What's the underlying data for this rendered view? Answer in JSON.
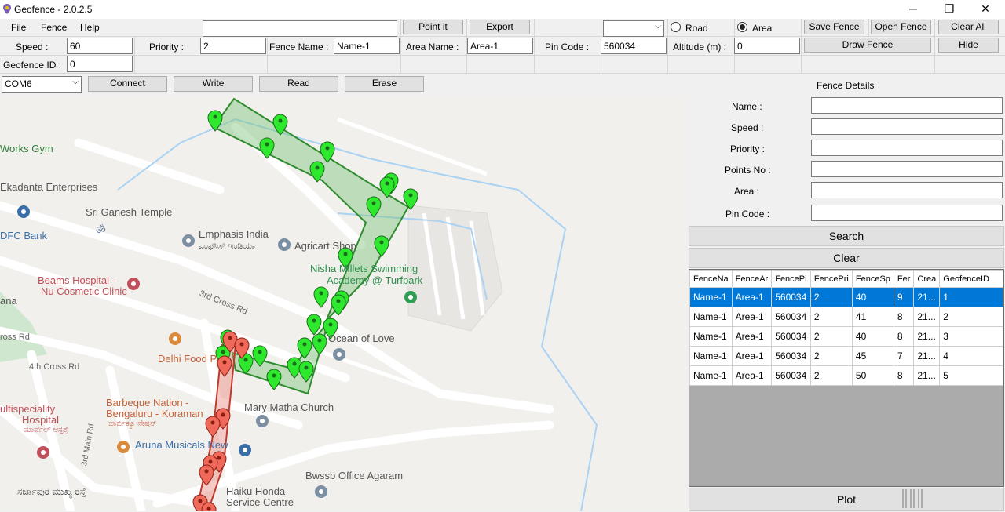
{
  "window": {
    "title": "Geofence - 2.0.2.5",
    "minimize": "─",
    "maximize": "❐",
    "close": "✕"
  },
  "menu": [
    "File",
    "Fence",
    "Help"
  ],
  "toolbar": {
    "speed_label": "Speed :",
    "speed_value": "60",
    "priority_label": "Priority :",
    "priority_value": "2",
    "fence_name_label": "Fence Name :",
    "fence_name_value": "Name-1",
    "area_name_label": "Area Name :",
    "area_name_value": "Area-1",
    "pin_code_label": "Pin Code :",
    "pin_code_value": "560034",
    "altitude_label": "Altitude (m) :",
    "altitude_value": "0",
    "geofence_id_label": "Geofence ID :",
    "geofence_id_value": "0",
    "search_value": "",
    "point_it": "Point it",
    "export": "Export",
    "dropdown_value": "",
    "radio_road": "Road",
    "radio_area": "Area",
    "selected_radio": "Area",
    "save_fence": "Save Fence",
    "open_fence": "Open Fence",
    "clear_all": "Clear All",
    "draw_fence": "Draw Fence",
    "hide": "Hide"
  },
  "serial": {
    "port": "COM6",
    "connect": "Connect",
    "write": "Write",
    "read": "Read",
    "erase": "Erase"
  },
  "details": {
    "title": "Fence Details",
    "fields": [
      {
        "label": "Name :",
        "value": ""
      },
      {
        "label": "Speed :",
        "value": ""
      },
      {
        "label": "Priority :",
        "value": ""
      },
      {
        "label": "Points No :",
        "value": ""
      },
      {
        "label": "Area :",
        "value": ""
      },
      {
        "label": "Pin Code :",
        "value": ""
      }
    ],
    "search": "Search",
    "clear": "Clear",
    "plot": "Plot"
  },
  "table": {
    "columns": [
      "FenceNa",
      "FenceAr",
      "FencePi",
      "FencePri",
      "FenceSp",
      "Fer",
      "Crea",
      "GeofenceID"
    ],
    "rows": [
      [
        "Name-1",
        "Area-1",
        "560034",
        "2",
        "40",
        "9",
        "21...",
        "1"
      ],
      [
        "Name-1",
        "Area-1",
        "560034",
        "2",
        "41",
        "8",
        "21...",
        "2"
      ],
      [
        "Name-1",
        "Area-1",
        "560034",
        "2",
        "40",
        "8",
        "21...",
        "3"
      ],
      [
        "Name-1",
        "Area-1",
        "560034",
        "2",
        "45",
        "7",
        "21...",
        "4"
      ],
      [
        "Name-1",
        "Area-1",
        "560034",
        "2",
        "50",
        "8",
        "21...",
        "5"
      ]
    ],
    "selected_row": 0
  },
  "map_labels": {
    "works_gym": "Works Gym",
    "ekadanta": "Ekadanta Enterprises",
    "ganesh": "Sri Ganesh Temple",
    "hdfc": "DFC Bank",
    "emphasis": "Emphasis India",
    "emphasis_kn": "ಎಂಫಸಿಸ್ ಇಂಡಿಯಾ",
    "agricart": "Agricart Shop",
    "nisha": "Nisha Millets Swimming",
    "nisha2": "Academy @ Turfpark",
    "beams": "Beams Hospital -",
    "beams2": "Nu Cosmetic Clinic",
    "third_cross": "3rd Cross Rd",
    "ross_rd": "ross Rd",
    "ana": "ana",
    "fourth_cross": "4th Cross Rd",
    "delhi": "Delhi Food P",
    "ocean": "Ocean of Love",
    "barbeque": "Barbeque Nation -",
    "barbeque2": "Bengaluru - Koraman",
    "barbeque_kn": "ಬಾರ್ಬಿಕ್ಯೂ ನೇಷನ್",
    "multi": "ultispeciality",
    "multi2": "Hospital",
    "multi_kn": "ಮಾರ್ವೆಲ್ ಆಸ್ಪತ್ರೆ",
    "mary": "Mary Matha Church",
    "third_main": "3rd Main Rd",
    "aruna": "Aruna Musicals New",
    "bwssb": "Bwssb Office Agaram",
    "haiku": "Haiku Honda",
    "haiku2": "Service Centre",
    "sarjapur_kn": "ಸರ್ಜಾಪುರ ಮುಖ್ಯ ರಸ್ತೆ"
  },
  "colors": {
    "green_fence": "#2e8b2e",
    "green_fill": "#7cc47c",
    "red_fence": "#c0392b",
    "selection": "#0078d7",
    "map_bg": "#f2f0ec",
    "water": "#a9d2f3"
  }
}
